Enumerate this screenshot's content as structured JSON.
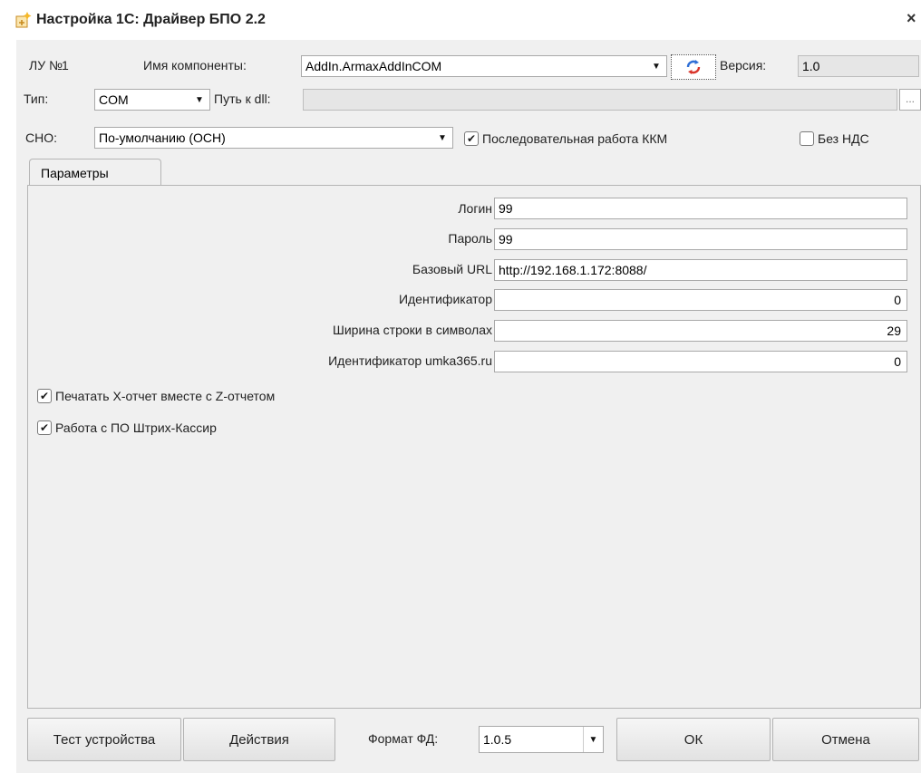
{
  "window": {
    "title": "Настройка 1С: Драйвер БПО 2.2",
    "close_label": "×"
  },
  "header": {
    "lu_label": "ЛУ №",
    "lu_number": "1",
    "component_label": "Имя компоненты:",
    "component_value": "AddIn.ArmaxAddInCOM",
    "version_label": "Версия:",
    "version_value": "1.0",
    "type_label": "Тип:",
    "type_value": "COM",
    "dll_label": "Путь к dll:",
    "dll_value": "",
    "dll_browse_label": "...",
    "sno_label": "СНО:",
    "sno_value": "По-умолчанию (ОСН)",
    "sequential_label": "Последовательная работа ККМ",
    "sequential_checked": true,
    "no_vat_label": "Без НДС",
    "no_vat_checked": false
  },
  "tabs": [
    {
      "label": "Параметры"
    }
  ],
  "params": {
    "login_label": "Логин",
    "login_value": "99",
    "password_label": "Пароль",
    "password_value": "99",
    "url_label": "Базовый URL",
    "url_value": "http://192.168.1.172:8088/",
    "id_label": "Идентификатор",
    "id_value": "0",
    "width_label": "Ширина строки в символах",
    "width_value": "29",
    "umka_label": "Идентификатор umka365.ru",
    "umka_value": "0",
    "print_x_label": "Печатать X-отчет вместе с Z-отчетом",
    "print_x_checked": true,
    "shtrih_label": "Работа с ПО Штрих-Кассир",
    "shtrih_checked": true
  },
  "footer": {
    "test_label": "Тест устройства",
    "actions_label": "Действия",
    "format_label": "Формат ФД:",
    "format_value": "1.0.5",
    "ok_label": "ОК",
    "cancel_label": "Отмена"
  },
  "icons": {
    "check_glyph": "✔",
    "dropdown_glyph": "▼"
  },
  "colors": {
    "dialog_bg": "#f0f0f0",
    "disabled_field": "#e6e6e6",
    "refresh_blue": "#2f6fd6",
    "refresh_red": "#d9342b"
  }
}
